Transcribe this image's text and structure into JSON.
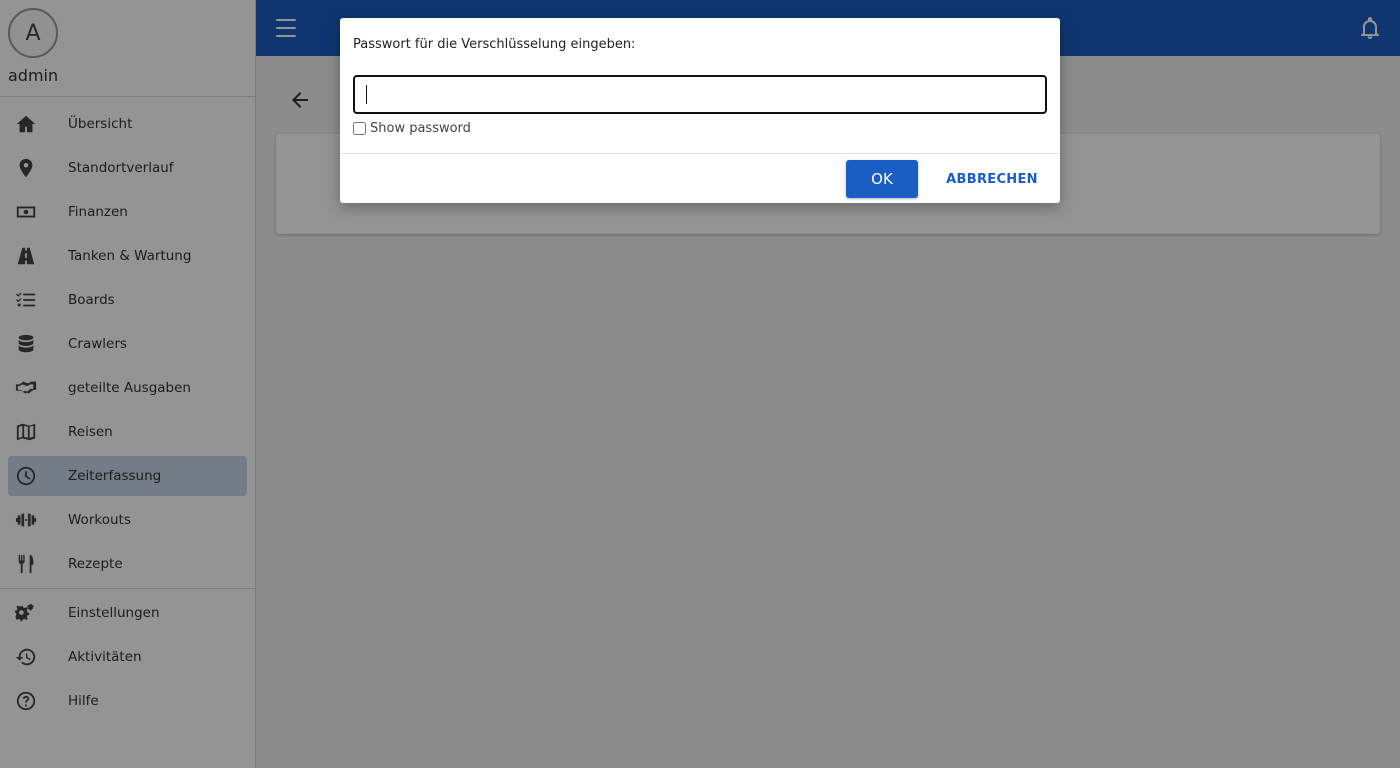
{
  "user": {
    "avatar_letter": "A",
    "name": "admin"
  },
  "sidebar": {
    "items": [
      {
        "label": "Übersicht",
        "icon": "home-icon"
      },
      {
        "label": "Standortverlauf",
        "icon": "location-pin-icon"
      },
      {
        "label": "Finanzen",
        "icon": "money-icon"
      },
      {
        "label": "Tanken & Wartung",
        "icon": "road-icon"
      },
      {
        "label": "Boards",
        "icon": "task-list-icon"
      },
      {
        "label": "Crawlers",
        "icon": "database-icon"
      },
      {
        "label": "geteilte Ausgaben",
        "icon": "handshake-icon"
      },
      {
        "label": "Reisen",
        "icon": "map-icon"
      },
      {
        "label": "Zeiterfassung",
        "icon": "clock-icon",
        "active": true
      },
      {
        "label": "Workouts",
        "icon": "dumbbell-icon"
      },
      {
        "label": "Rezepte",
        "icon": "utensils-icon"
      }
    ],
    "bottom_items": [
      {
        "label": "Einstellungen",
        "icon": "gears-icon"
      },
      {
        "label": "Aktivitäten",
        "icon": "history-icon"
      },
      {
        "label": "Hilfe",
        "icon": "help-icon"
      }
    ]
  },
  "header": {
    "menu_icon": "hamburger-icon",
    "notification_icon": "bell-icon"
  },
  "main": {
    "back_icon": "arrow-left-icon"
  },
  "dialog": {
    "prompt": "Passwort für die Verschlüsselung eingeben:",
    "password_value": "",
    "show_password_label": "Show password",
    "show_password_checked": false,
    "ok_label": "OK",
    "cancel_label": "ABBRECHEN"
  },
  "colors": {
    "primary": "#1a5ec3",
    "active_nav": "#c8d6e8",
    "overlay": "rgba(0,0,0,0.42)"
  }
}
